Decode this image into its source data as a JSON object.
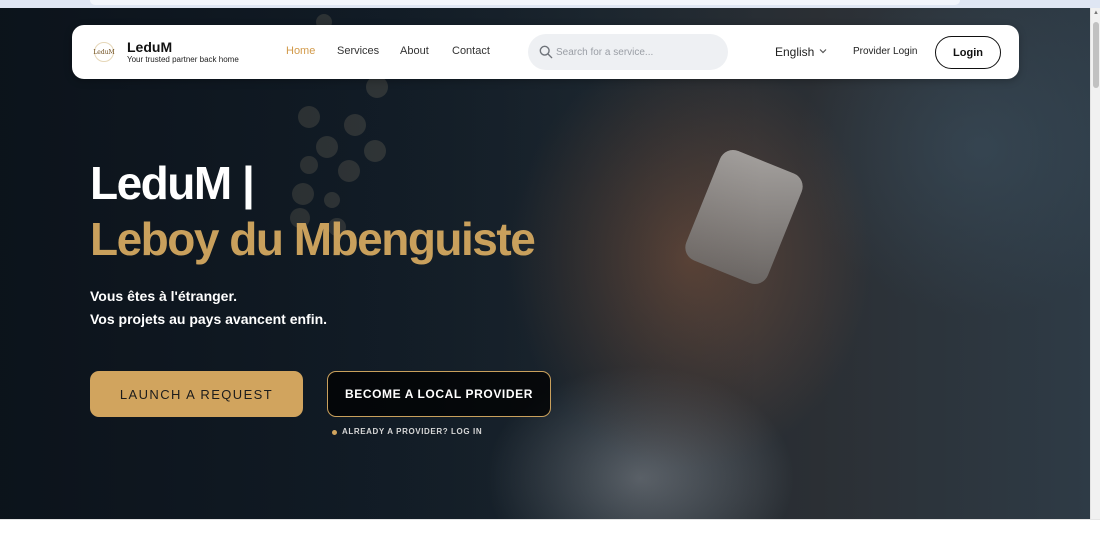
{
  "colors": {
    "accent": "#c9a05c",
    "button_gold": "#d1a45e",
    "active_nav": "#d29a4a",
    "navbar_bg": "#ffffff"
  },
  "header": {
    "logo_icon": "leduM-logo-icon",
    "logo_mark_text": "LeduM",
    "brand_name": "LeduM",
    "brand_tagline": "Your trusted partner back home",
    "nav": [
      {
        "label": "Home",
        "active": true
      },
      {
        "label": "Services",
        "active": false
      },
      {
        "label": "About",
        "active": false
      },
      {
        "label": "Contact",
        "active": false
      }
    ],
    "search": {
      "placeholder": "Search for a service...",
      "value": "",
      "icon": "search-icon"
    },
    "language": {
      "selected": "English",
      "icon": "chevron-down-icon"
    },
    "provider_login_label": "Provider Login",
    "login_label": "Login"
  },
  "hero": {
    "title": "LeduM |",
    "subtitle": "Leboy du Mbenguiste",
    "line1": "Vous êtes à l'étranger.",
    "line2": "Vos projets au pays avancent enfin.",
    "primary_cta": "LAUNCH A REQUEST",
    "secondary_cta": "BECOME A LOCAL PROVIDER",
    "already_provider_link": "ALREADY A PROVIDER? LOG IN"
  }
}
